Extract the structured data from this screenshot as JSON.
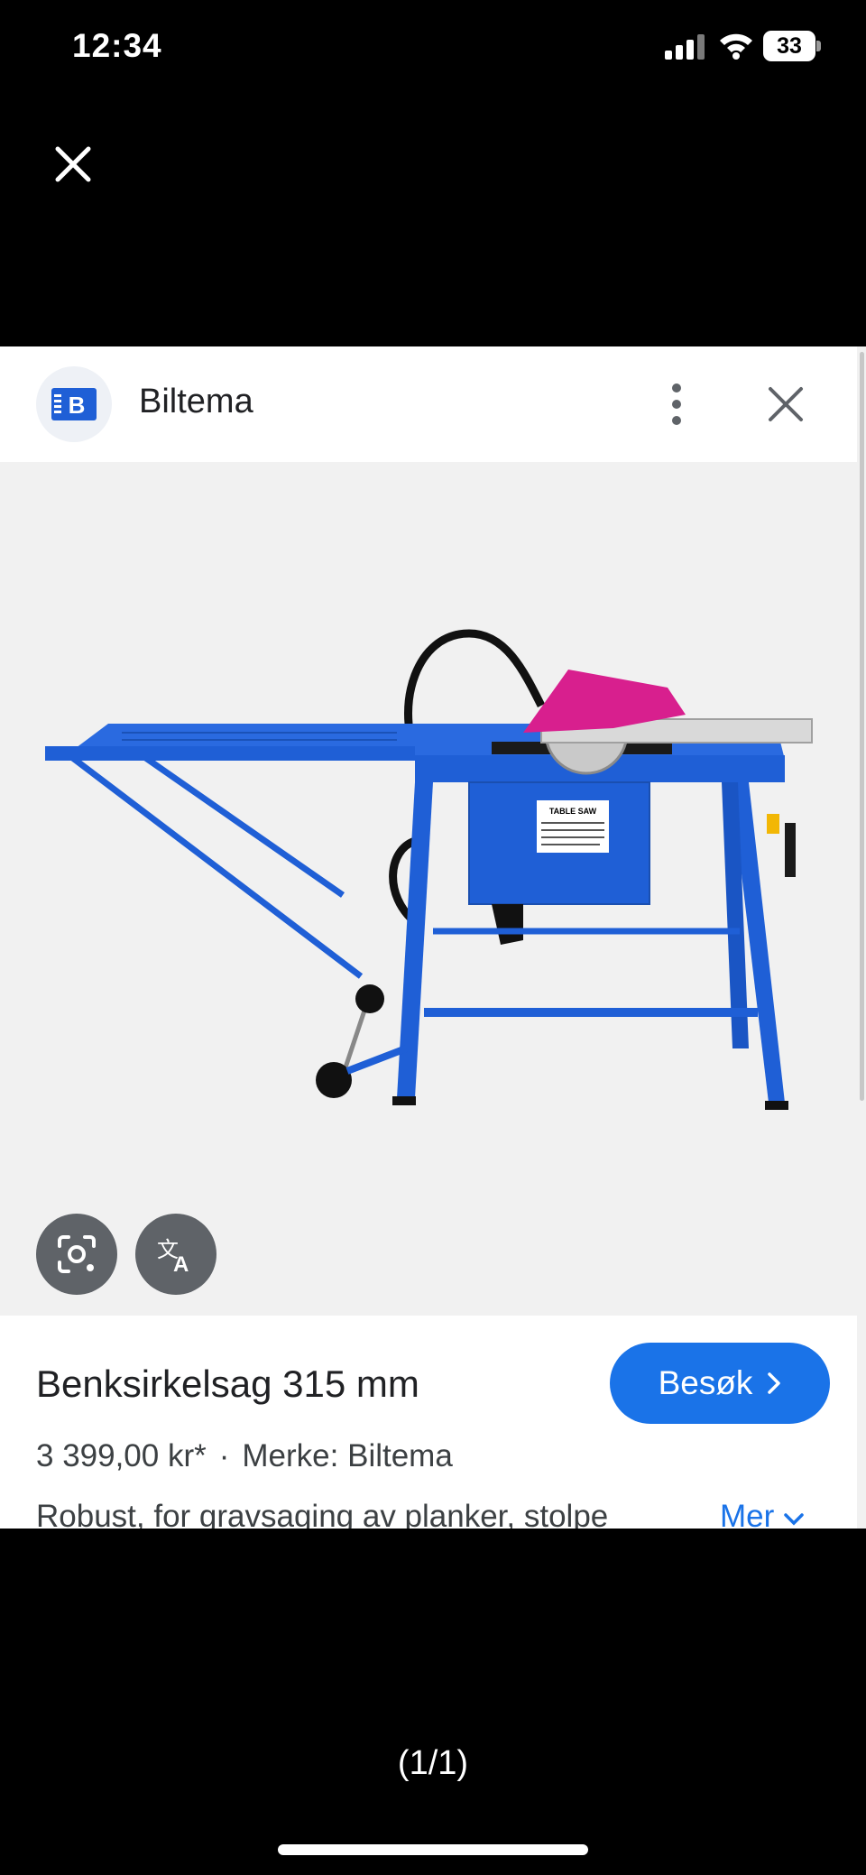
{
  "status_bar": {
    "time": "12:34",
    "battery": "33"
  },
  "card": {
    "site_name": "Biltema",
    "logo_letter": "B",
    "product_title": "Benksirkelsag 315 mm",
    "visit_label": "Besøk",
    "price": "3 399,00 kr*",
    "separator": "·",
    "brand": "Merke: Biltema",
    "description": "Robust, for gravsaging av planker, stolpe",
    "more_label": "Mer",
    "image_label": "TABLE SAW"
  },
  "viewer": {
    "pager": "(1/1)"
  },
  "colors": {
    "accent": "#1a73e8",
    "saw_blue": "#1f5fd6",
    "guard_pink": "#d81f8e"
  },
  "icons": [
    "close-icon",
    "more-vert-icon",
    "lens-icon",
    "translate-icon",
    "chevron-right-icon",
    "chevron-down-icon"
  ]
}
